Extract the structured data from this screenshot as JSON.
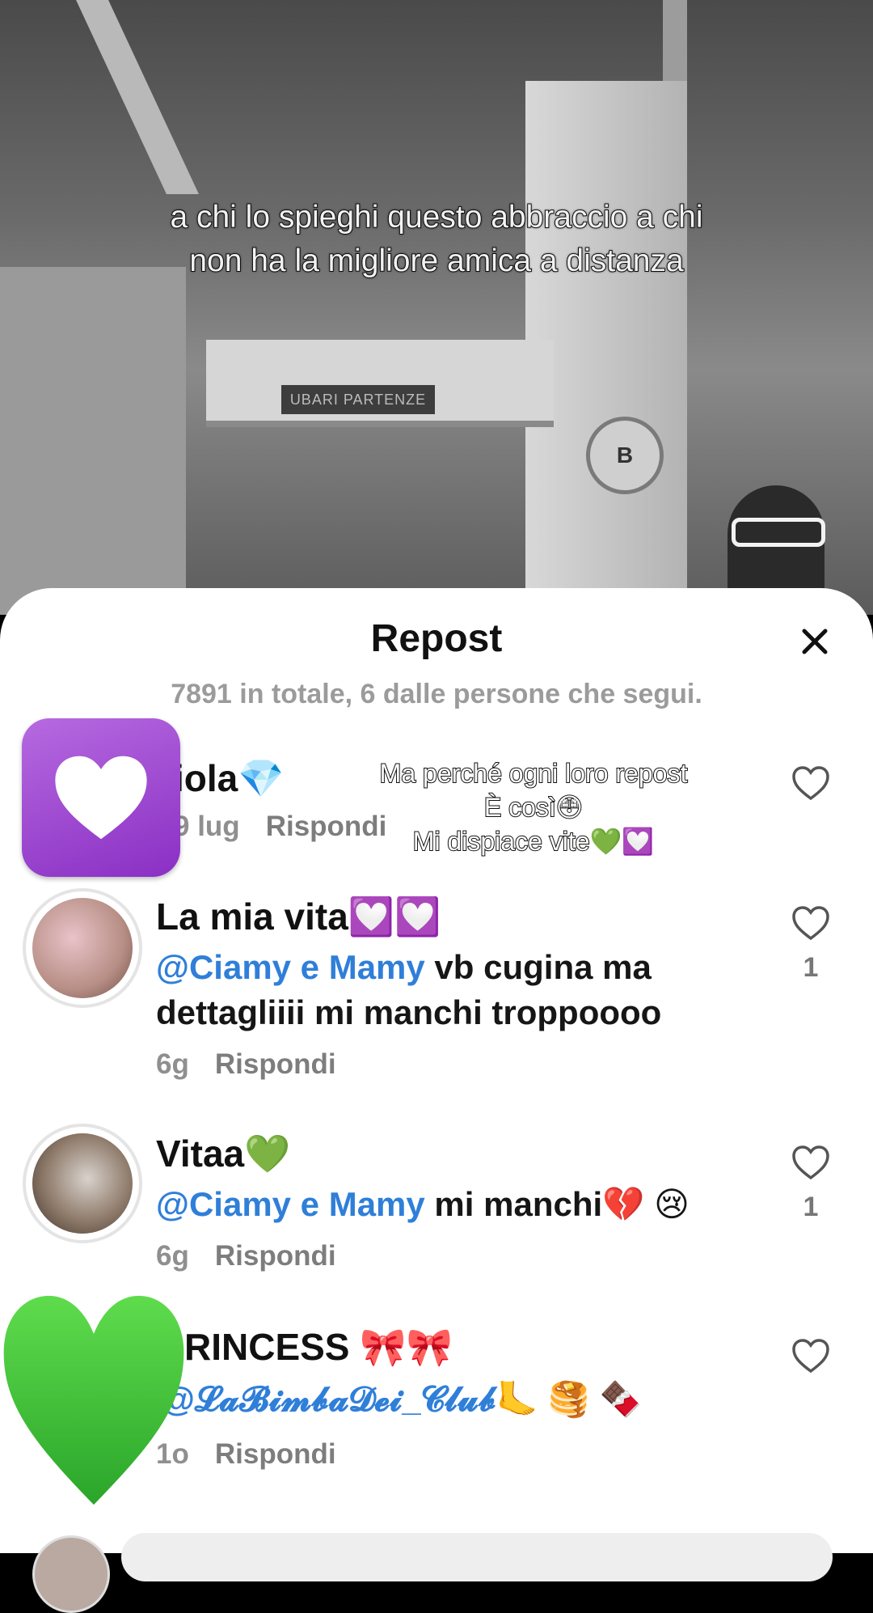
{
  "video": {
    "caption_line1": "a chi lo spieghi questo abbraccio a chi",
    "caption_line2": "non ha la migliore amica a distanza",
    "sign_text": "UBARI PARTENZE",
    "circle_sign": "B"
  },
  "sheet": {
    "title": "Repost",
    "close_icon": "close-icon",
    "subtitle": "7891 in totale, 6 dalle persone che segui."
  },
  "overlay": {
    "line1": "Ma perché ogni loro repost",
    "line2": "È così😳",
    "line3": "Mi dispiace vite💚💟"
  },
  "comments": [
    {
      "name": "iola💎",
      "mention": "",
      "text": "",
      "time": "9 lug",
      "reply": "Rispondi",
      "likes": ""
    },
    {
      "name": "La mia vita💟💟",
      "mention": "@Ciamy e Mamy",
      "text": " vb cugina ma dettagliiii mi manchi troppoooo",
      "time": "6g",
      "reply": "Rispondi",
      "likes": "1"
    },
    {
      "name": "Vitaa💚",
      "mention": "@Ciamy e Mamy",
      "text": " mi manchi💔 😢",
      "time": "6g",
      "reply": "Rispondi",
      "likes": "1"
    },
    {
      "name": "RINCESS 🎀🎀",
      "mention": "@𝓛𝓪𝓑𝓲𝓶𝓫𝓪𝓓𝓮𝓲_𝓒𝓵𝓾𝓫",
      "text": "🦶 🥞 🍫",
      "time": "1o",
      "reply": "Rispondi",
      "likes": ""
    }
  ],
  "colors": {
    "mention": "#2f7fd9",
    "sheet_bg": "#ffffff",
    "purple_tile": "#9b45d0",
    "green_heart": "#3cc13b"
  }
}
